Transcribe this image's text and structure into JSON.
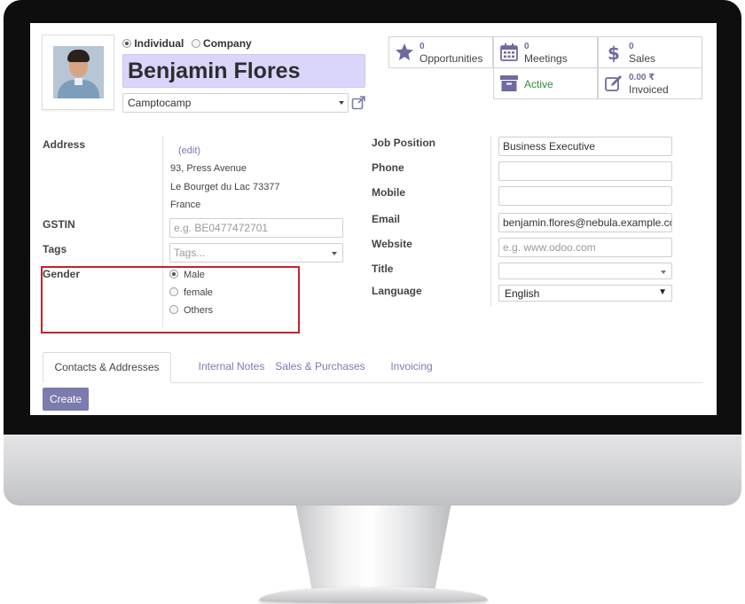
{
  "partner": {
    "type_options": [
      {
        "label": "Individual",
        "selected": true
      },
      {
        "label": "Company",
        "selected": false
      }
    ],
    "name": "Benjamin Flores",
    "company": "Camptocamp"
  },
  "smart_buttons": {
    "opportunities": {
      "count": "0",
      "label": "Opportunities"
    },
    "meetings": {
      "count": "0",
      "label": "Meetings"
    },
    "sales": {
      "count": "0",
      "label": "Sales"
    },
    "archive": {
      "label": "Active"
    },
    "invoiced": {
      "amount": "0.00 ₹",
      "label": "Invoiced"
    }
  },
  "left_form": {
    "address_label": "Address",
    "edit_link": "(edit)",
    "street": "93, Press Avenue",
    "city_line": "Le Bourget du Lac 73377",
    "country": "France",
    "gstin_label": "GSTIN",
    "gstin_placeholder": "e.g. BE0477472701",
    "tags_label": "Tags",
    "tags_placeholder": "Tags...",
    "gender_label": "Gender",
    "gender_options": [
      {
        "label": "Male",
        "selected": true
      },
      {
        "label": "female",
        "selected": false
      },
      {
        "label": "Others",
        "selected": false
      }
    ]
  },
  "right_form": {
    "job_position_label": "Job Position",
    "job_position": "Business Executive",
    "phone_label": "Phone",
    "phone": "",
    "mobile_label": "Mobile",
    "mobile": "",
    "email_label": "Email",
    "email": "benjamin.flores@nebula.example.com",
    "website_label": "Website",
    "website_placeholder": "e.g. www.odoo.com",
    "title_label": "Title",
    "title": "",
    "language_label": "Language",
    "language": "English"
  },
  "tabs": [
    {
      "label": "Contacts & Addresses",
      "active": true
    },
    {
      "label": "Internal Notes",
      "active": false
    },
    {
      "label": "Sales & Purchases",
      "active": false
    },
    {
      "label": "Invoicing",
      "active": false
    }
  ],
  "create_label": "Create",
  "colors": {
    "accent": "#7c7bad",
    "name_highlight": "#d9d5fb",
    "link": "#7d78b3",
    "active_status": "#2f8a3b",
    "annotation_box": "#c7202f"
  }
}
